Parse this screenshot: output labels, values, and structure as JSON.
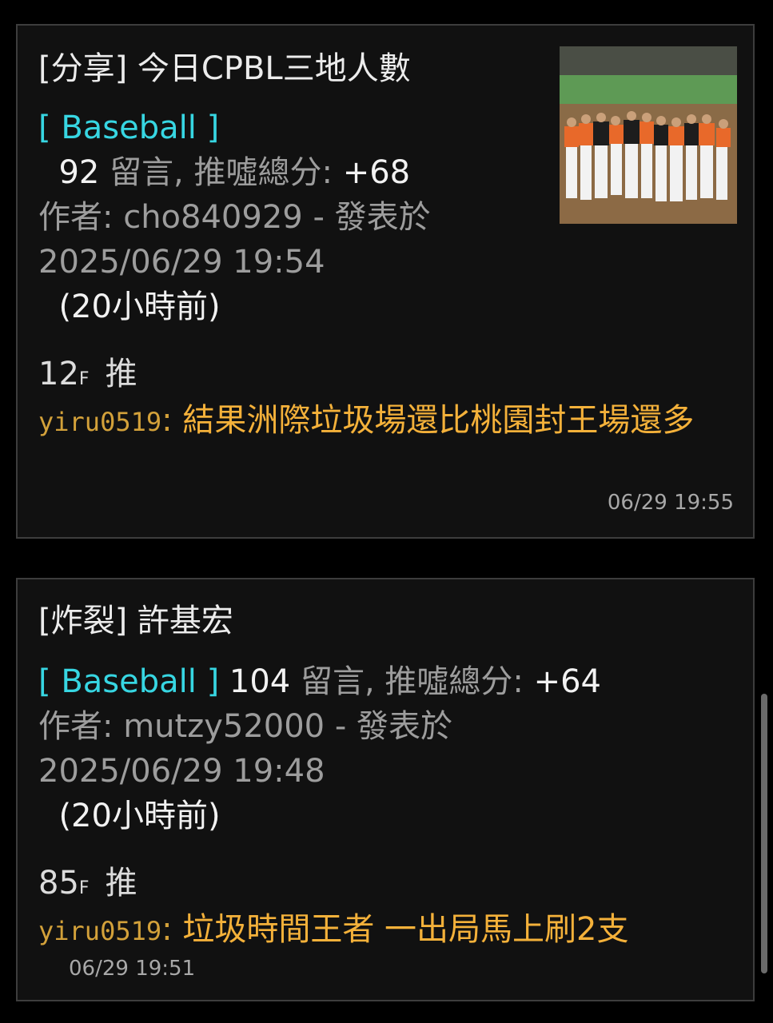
{
  "posts": [
    {
      "title": "[分享] 今日CPBL三地人數",
      "board": "[ Baseball ]",
      "comment_count": "92",
      "comment_label": "留言, 推噓總分:",
      "score": "+68",
      "author_label": "作者:",
      "author": "cho840929",
      "posted_label": "- 發表於",
      "datetime": "2025/06/29 19:54",
      "relative_time": "(20小時前)",
      "floor_number": "12",
      "floor_suffix": "F",
      "push_tag": "推",
      "push_user": "yiru0519",
      "push_text": "結果洲際垃圾場還比桃園封王場還多",
      "push_time": "06/29 19:55"
    },
    {
      "title": "[炸裂] 許基宏",
      "board": "[ Baseball ]",
      "comment_count": "104",
      "comment_label": "留言, 推噓總分:",
      "score": "+64",
      "author_label": "作者:",
      "author": "mutzy52000",
      "posted_label": "- 發表於",
      "datetime": "2025/06/29 19:48",
      "relative_time": "(20小時前)",
      "floor_number": "85",
      "floor_suffix": "F",
      "push_tag": "推",
      "push_user": "yiru0519",
      "push_text": "垃圾時間王者 一出局馬上刷2支",
      "push_time": "06/29 19:51"
    }
  ],
  "colors": {
    "background": "#000000",
    "card": "#111111",
    "board_tag": "#37d6e2",
    "push_text": "#f4b13a",
    "push_user": "#d3a13a"
  }
}
